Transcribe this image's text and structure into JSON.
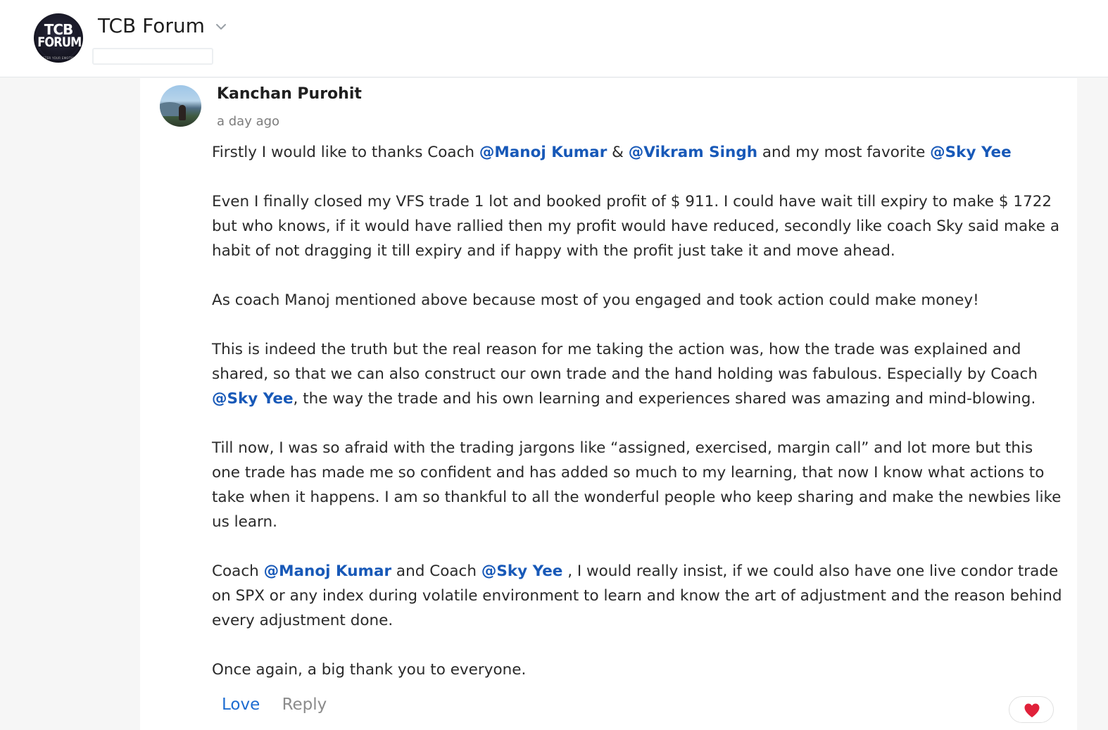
{
  "header": {
    "forum_name": "TCB Forum",
    "logo_line1": "TCB",
    "logo_line2": "FORUM",
    "logo_tagline": "MASTER YOUR EMOTIONS",
    "switcher_icon": "chevron-down-icon"
  },
  "post": {
    "author": "Kanchan Purohit",
    "timestamp": "a day ago",
    "paragraphs": [
      [
        {
          "t": "Firstly I would like to thanks Coach "
        },
        {
          "m": "@Manoj Kumar"
        },
        {
          "t": " & "
        },
        {
          "m": "@Vikram Singh"
        },
        {
          "t": " and my most favorite "
        },
        {
          "m": "@Sky Yee"
        }
      ],
      [
        {
          "t": "Even I finally closed my VFS trade 1 lot and booked profit of $ 911. I could have wait till expiry to make $ 1722 but who knows, if it would have rallied then my profit would have reduced, secondly like coach Sky said make a habit of not dragging it till expiry and if happy with the profit just take it and move ahead."
        }
      ],
      [
        {
          "t": "As coach Manoj mentioned above because most of you engaged and took action could make money!"
        }
      ],
      [
        {
          "t": "This is indeed the truth but the real reason for me taking the action was, how the trade was explained and shared, so that we can also construct our own trade and the hand holding was fabulous. Especially by Coach "
        },
        {
          "m": "@Sky Yee"
        },
        {
          "t": ", the way the trade and his own learning and experiences shared was amazing and mind-blowing."
        }
      ],
      [
        {
          "t": "Till now, I was so afraid with the trading jargons like “assigned, exercised, margin call” and lot more but this one trade has made me so confident and has added so much to my learning, that now I know what actions to take when it happens.  I am so thankful to all the wonderful people who keep sharing and make the newbies like us learn."
        }
      ],
      [
        {
          "t": "Coach "
        },
        {
          "m": "@Manoj Kumar"
        },
        {
          "t": "  and Coach "
        },
        {
          "m": "@Sky Yee"
        },
        {
          "t": " , I would really insist, if we could also have one live condor trade on SPX or any index during volatile environment to learn and know the art of adjustment and the reason behind every adjustment done."
        }
      ],
      [
        {
          "t": "Once again, a big thank you to everyone."
        }
      ]
    ],
    "actions": {
      "love_label": "Love",
      "reply_label": "Reply"
    },
    "reaction_icon": "heart-icon",
    "colors": {
      "mention": "#1859b8",
      "love_action": "#1d6cd1",
      "heart": "#e0213a"
    }
  }
}
